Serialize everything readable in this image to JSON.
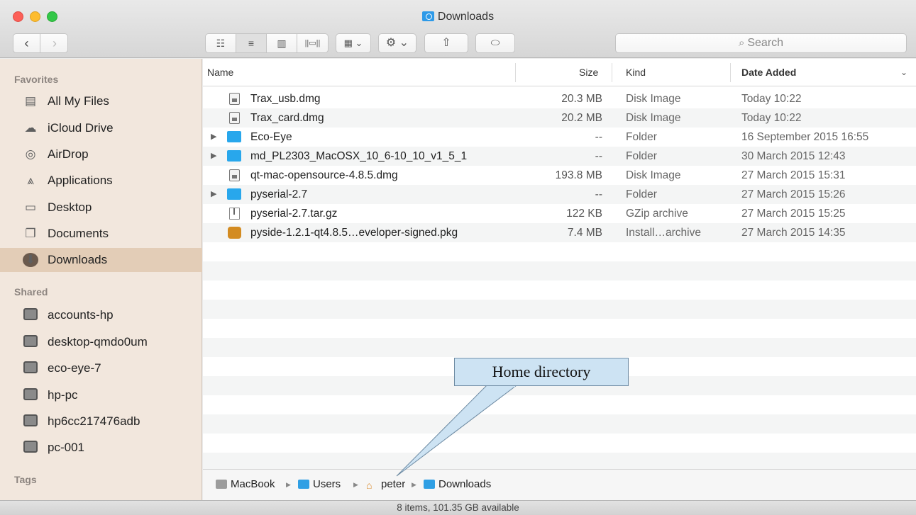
{
  "window": {
    "title": "Downloads"
  },
  "toolbar": {
    "back_label": "‹",
    "forward_label": "›",
    "view_icons": "☷",
    "view_list": "≡",
    "view_columns": "▥",
    "view_coverflow": "||▭||",
    "arrange_label": "▦ ⌄",
    "action_label": "⚙ ⌄",
    "share_label": "⇧",
    "tag_label": "⬭",
    "search_placeholder": "Search",
    "search_icon": "🔍"
  },
  "sidebar": {
    "favorites_label": "Favorites",
    "favorites": [
      {
        "label": "All My Files",
        "icon": "all-my-files-icon",
        "glyph": "▤"
      },
      {
        "label": "iCloud Drive",
        "icon": "cloud-icon",
        "glyph": "☁"
      },
      {
        "label": "AirDrop",
        "icon": "airdrop-icon",
        "glyph": "◎"
      },
      {
        "label": "Applications",
        "icon": "applications-icon",
        "glyph": "⩓"
      },
      {
        "label": "Desktop",
        "icon": "desktop-icon",
        "glyph": "▭"
      },
      {
        "label": "Documents",
        "icon": "documents-icon",
        "glyph": "❐"
      },
      {
        "label": "Downloads",
        "icon": "downloads-icon",
        "glyph": "⬇"
      }
    ],
    "shared_label": "Shared",
    "shared": [
      {
        "label": "accounts-hp"
      },
      {
        "label": "desktop-qmdo0um"
      },
      {
        "label": "eco-eye-7"
      },
      {
        "label": "hp-pc"
      },
      {
        "label": "hp6cc217476adb"
      },
      {
        "label": "pc-001"
      }
    ],
    "tags_label": "Tags"
  },
  "columns": {
    "name": "Name",
    "size": "Size",
    "kind": "Kind",
    "date_added": "Date Added",
    "sort_indicator": "⌄"
  },
  "files": [
    {
      "name": "Trax_usb.dmg",
      "size": "20.3 MB",
      "kind": "Disk Image",
      "date": "Today 10:22",
      "type": "dmg",
      "expandable": false
    },
    {
      "name": "Trax_card.dmg",
      "size": "20.2 MB",
      "kind": "Disk Image",
      "date": "Today 10:22",
      "type": "dmg",
      "expandable": false
    },
    {
      "name": "Eco-Eye",
      "size": "--",
      "kind": "Folder",
      "date": "16 September 2015 16:55",
      "type": "folder",
      "expandable": true
    },
    {
      "name": "md_PL2303_MacOSX_10_6-10_10_v1_5_1",
      "size": "--",
      "kind": "Folder",
      "date": "30 March 2015 12:43",
      "type": "folder",
      "expandable": true
    },
    {
      "name": "qt-mac-opensource-4.8.5.dmg",
      "size": "193.8 MB",
      "kind": "Disk Image",
      "date": "27 March 2015 15:31",
      "type": "dmg",
      "expandable": false
    },
    {
      "name": "pyserial-2.7",
      "size": "--",
      "kind": "Folder",
      "date": "27 March 2015 15:26",
      "type": "folder",
      "expandable": true
    },
    {
      "name": "pyserial-2.7.tar.gz",
      "size": "122 KB",
      "kind": "GZip archive",
      "date": "27 March 2015 15:25",
      "type": "tgz",
      "expandable": false
    },
    {
      "name": "pyside-1.2.1-qt4.8.5…eveloper-signed.pkg",
      "size": "7.4 MB",
      "kind": "Install…archive",
      "date": "27 March 2015 14:35",
      "type": "pkg",
      "expandable": false
    }
  ],
  "pathbar": {
    "crumbs": [
      "MacBook",
      "Users",
      "peter",
      "Downloads"
    ],
    "separator": "▶"
  },
  "status": {
    "text": "8 items, 101.35 GB available"
  },
  "annotation": {
    "text": "Home directory"
  },
  "colors": {
    "sidebar_bg": "#f2e7dd",
    "sidebar_selected": "#e3cdb7",
    "folder_blue": "#28a7ec",
    "callout_fill": "#cde3f3"
  }
}
